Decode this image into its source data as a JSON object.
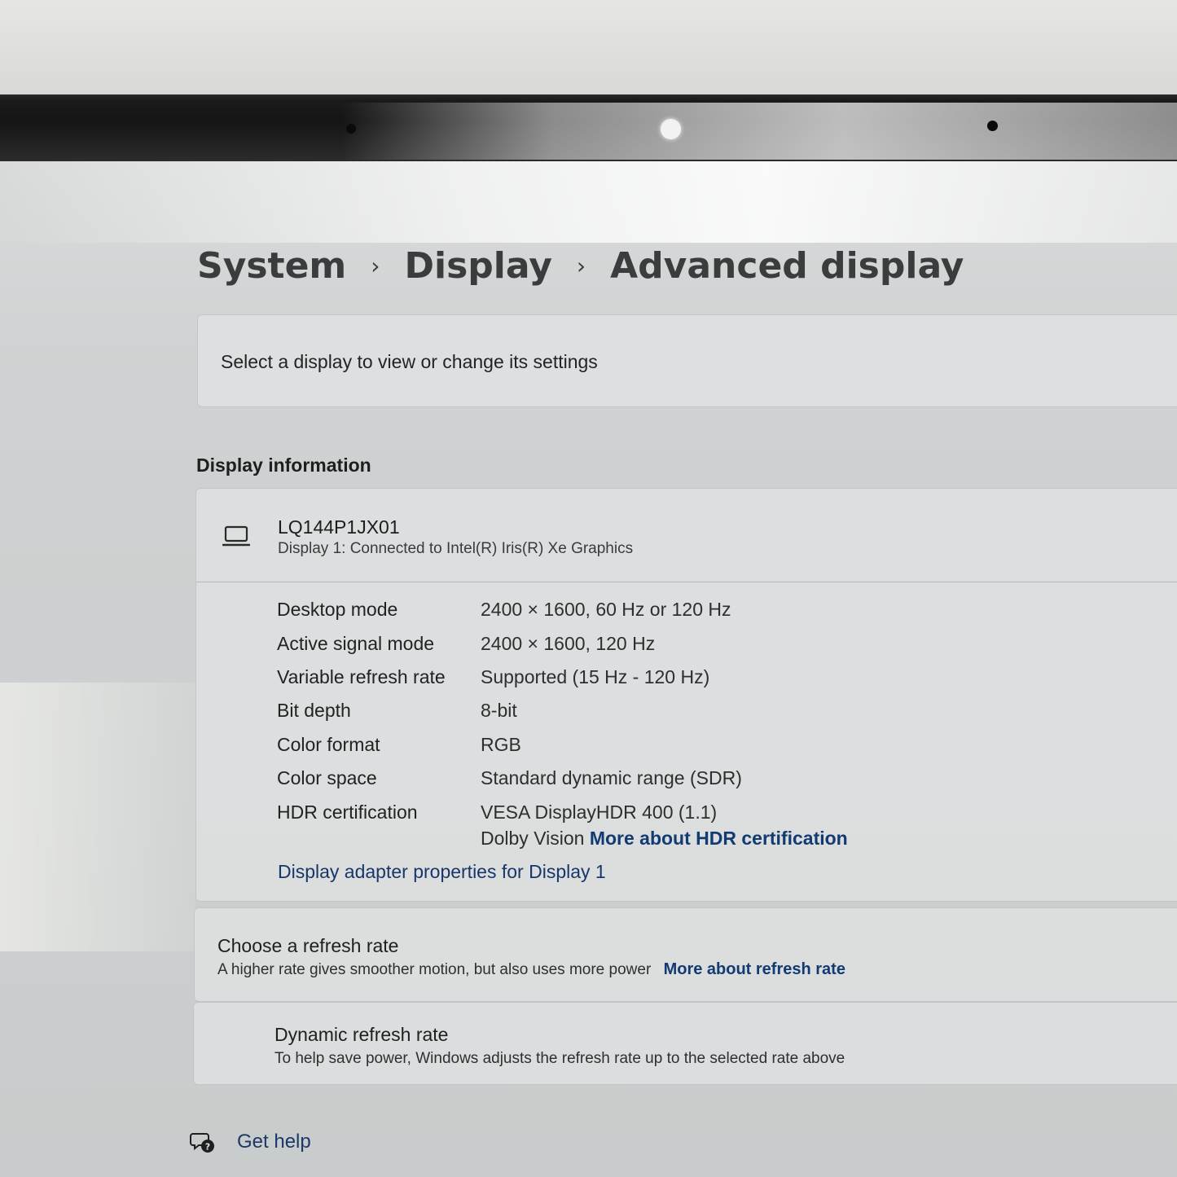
{
  "breadcrumb": {
    "items": [
      "System",
      "Display",
      "Advanced display"
    ],
    "separator": "›"
  },
  "select_display": {
    "label": "Select a display to view or change its settings"
  },
  "display_information": {
    "section_title": "Display information",
    "monitor_icon": "laptop-icon",
    "monitor_name": "LQ144P1JX01",
    "monitor_subtitle": "Display 1: Connected to Intel(R) Iris(R) Xe Graphics",
    "rows": [
      {
        "label": "Desktop mode",
        "value": "2400 × 1600, 60 Hz or 120 Hz"
      },
      {
        "label": "Active signal mode",
        "value": "2400 × 1600, 120 Hz"
      },
      {
        "label": "Variable refresh rate",
        "value": "Supported (15 Hz - 120 Hz)"
      },
      {
        "label": "Bit depth",
        "value": "8-bit"
      },
      {
        "label": "Color format",
        "value": "RGB"
      },
      {
        "label": "Color space",
        "value": "Standard dynamic range (SDR)"
      },
      {
        "label": "HDR certification",
        "value": "VESA DisplayHDR 400 (1.1)"
      }
    ],
    "hdr_second_line": "Dolby Vision",
    "hdr_link": "More about HDR certification",
    "adapter_link": "Display adapter properties for Display 1"
  },
  "refresh_rate": {
    "title": "Choose a refresh rate",
    "subtitle": "A higher rate gives smoother motion, but also uses more power",
    "link": "More about refresh rate"
  },
  "dynamic_refresh": {
    "title": "Dynamic refresh rate",
    "subtitle": "To help save power, Windows adjusts the refresh rate up to the selected rate above"
  },
  "help": {
    "icon": "help-chat-icon",
    "label": "Get help"
  },
  "colors": {
    "link": "#123a73",
    "card_background": "#e2e4e4",
    "page_background": "#cfd1d1"
  }
}
